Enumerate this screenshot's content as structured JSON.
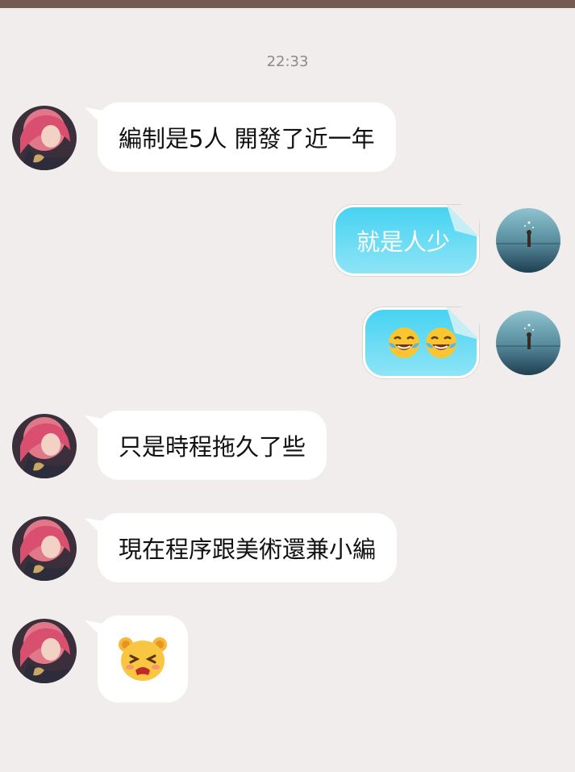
{
  "timestamp": "22:33",
  "messages": [
    {
      "side": "left",
      "text": "編制是5人 開發了近一年"
    },
    {
      "side": "right",
      "text": "就是人少"
    },
    {
      "side": "right",
      "emoji": [
        "laughing-crying-emoji",
        "laughing-crying-emoji"
      ]
    },
    {
      "side": "left",
      "text": "只是時程拖久了些"
    },
    {
      "side": "left",
      "text": "現在程序跟美術還兼小編"
    },
    {
      "side": "left",
      "emoji": [
        "frustrated-bear-emoji"
      ]
    }
  ],
  "colors": {
    "background": "#f0edec",
    "topbar": "#735b52",
    "incoming_bubble": "#ffffff",
    "outgoing_bubble": "#46d3f2"
  }
}
